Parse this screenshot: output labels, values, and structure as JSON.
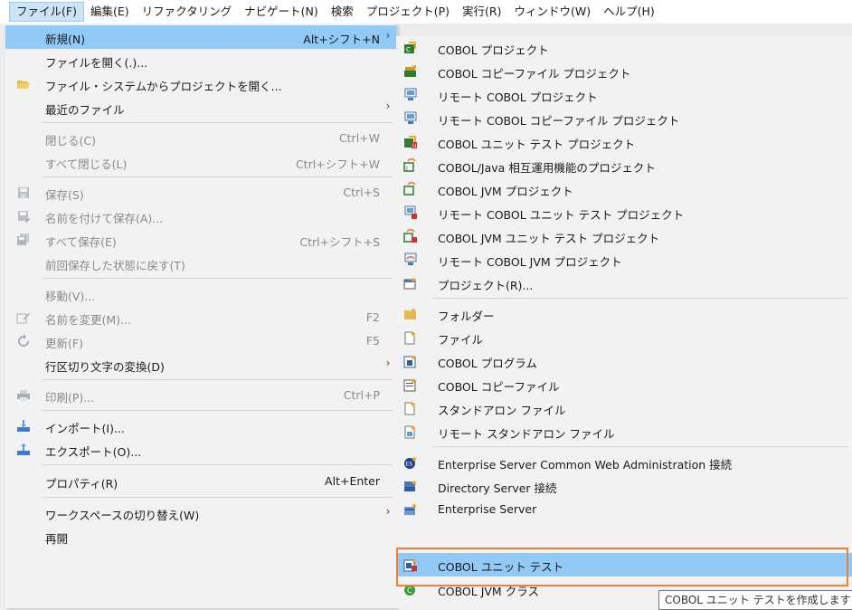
{
  "menubar": {
    "items": [
      {
        "label": "ファイル(F)",
        "name": "menu-file"
      },
      {
        "label": "編集(E)",
        "name": "menu-edit"
      },
      {
        "label": "リファクタリング",
        "name": "menu-refactor"
      },
      {
        "label": "ナビゲート(N)",
        "name": "menu-navigate"
      },
      {
        "label": "検索",
        "name": "menu-search"
      },
      {
        "label": "プロジェクト(P)",
        "name": "menu-project"
      },
      {
        "label": "実行(R)",
        "name": "menu-run"
      },
      {
        "label": "ウィンドウ(W)",
        "name": "menu-window"
      },
      {
        "label": "ヘルプ(H)",
        "name": "menu-help"
      }
    ]
  },
  "file_menu": {
    "items": [
      {
        "label": "新規(N)",
        "shortcut": "Alt+シフト+N",
        "submenu": true,
        "selected": true
      },
      {
        "label": "ファイルを開く(.)...",
        "shortcut": ""
      },
      {
        "label": "ファイル・システムからプロジェクトを開く...",
        "shortcut": "",
        "icon": "folder-open-icon"
      },
      {
        "label": "最近のファイル",
        "shortcut": "",
        "submenu": true
      },
      {
        "label": "閉じる(C)",
        "shortcut": "Ctrl+W",
        "disabled": true
      },
      {
        "label": "すべて閉じる(L)",
        "shortcut": "Ctrl+シフト+W",
        "disabled": true
      },
      {
        "label": "保存(S)",
        "shortcut": "Ctrl+S",
        "disabled": true,
        "icon": "save-icon"
      },
      {
        "label": "名前を付けて保存(A)...",
        "shortcut": "",
        "disabled": true,
        "icon": "save-as-icon"
      },
      {
        "label": "すべて保存(E)",
        "shortcut": "Ctrl+シフト+S",
        "disabled": true,
        "icon": "save-all-icon"
      },
      {
        "label": "前回保存した状態に戻す(T)",
        "shortcut": "",
        "disabled": true
      },
      {
        "label": "移動(V)...",
        "shortcut": "",
        "disabled": true
      },
      {
        "label": "名前を変更(M)...",
        "shortcut": "F2",
        "disabled": true,
        "icon": "rename-icon"
      },
      {
        "label": "更新(F)",
        "shortcut": "F5",
        "disabled": true,
        "icon": "refresh-icon"
      },
      {
        "label": "行区切り文字の変換(D)",
        "shortcut": "",
        "submenu": true
      },
      {
        "label": "印刷(P)...",
        "shortcut": "Ctrl+P",
        "disabled": true,
        "icon": "print-icon"
      },
      {
        "label": "インポート(I)...",
        "shortcut": "",
        "icon": "import-icon"
      },
      {
        "label": "エクスポート(O)...",
        "shortcut": "",
        "icon": "export-icon"
      },
      {
        "label": "プロパティ(R)",
        "shortcut": "Alt+Enter"
      },
      {
        "label": "ワークスペースの切り替え(W)",
        "shortcut": "",
        "submenu": true
      },
      {
        "label": "再開",
        "shortcut": ""
      }
    ]
  },
  "new_submenu": {
    "items": [
      {
        "label": "COBOL プロジェクト",
        "icon": "cobol-project-icon"
      },
      {
        "label": "COBOL コピーファイル プロジェクト",
        "icon": "cobol-copyfile-project-icon"
      },
      {
        "label": "リモート COBOL プロジェクト",
        "icon": "remote-cobol-project-icon"
      },
      {
        "label": "リモート COBOL コピーファイル プロジェクト",
        "icon": "remote-copyfile-project-icon"
      },
      {
        "label": "COBOL ユニット テスト プロジェクト",
        "icon": "unit-test-project-icon"
      },
      {
        "label": "COBOL/Java 相互運用機能のプロジェクト",
        "icon": "interop-project-icon"
      },
      {
        "label": "COBOL JVM プロジェクト",
        "icon": "jvm-project-icon"
      },
      {
        "label": "リモート COBOL ユニット テスト プロジェクト",
        "icon": "remote-unit-test-project-icon"
      },
      {
        "label": "COBOL JVM ユニット テスト プロジェクト",
        "icon": "jvm-unit-test-project-icon"
      },
      {
        "label": "リモート COBOL JVM プロジェクト",
        "icon": "remote-jvm-project-icon"
      },
      {
        "label": "プロジェクト(R)...",
        "icon": "project-icon"
      },
      {
        "label": "フォルダー",
        "icon": "folder-icon"
      },
      {
        "label": "ファイル",
        "icon": "file-icon"
      },
      {
        "label": "COBOL プログラム",
        "icon": "cobol-program-icon"
      },
      {
        "label": "COBOL コピーファイル",
        "icon": "cobol-copyfile-icon"
      },
      {
        "label": "スタンドアロン ファイル",
        "icon": "standalone-file-icon"
      },
      {
        "label": "リモート スタンドアロン ファイル",
        "icon": "remote-standalone-file-icon"
      },
      {
        "label": "Enterprise Server Common Web Administration 接続",
        "icon": "escwa-connection-icon"
      },
      {
        "label": "Directory Server 接続",
        "icon": "directory-server-icon"
      },
      {
        "label": "Enterprise Server",
        "icon": "enterprise-server-icon"
      },
      {
        "label": "COBOL ユニット テスト",
        "icon": "cobol-unit-test-icon",
        "selected": true
      },
      {
        "label": "COBOL JVM クラス",
        "icon": "jvm-class-icon"
      }
    ]
  },
  "tooltip": {
    "text": "COBOL ユニット テストを作成します"
  }
}
